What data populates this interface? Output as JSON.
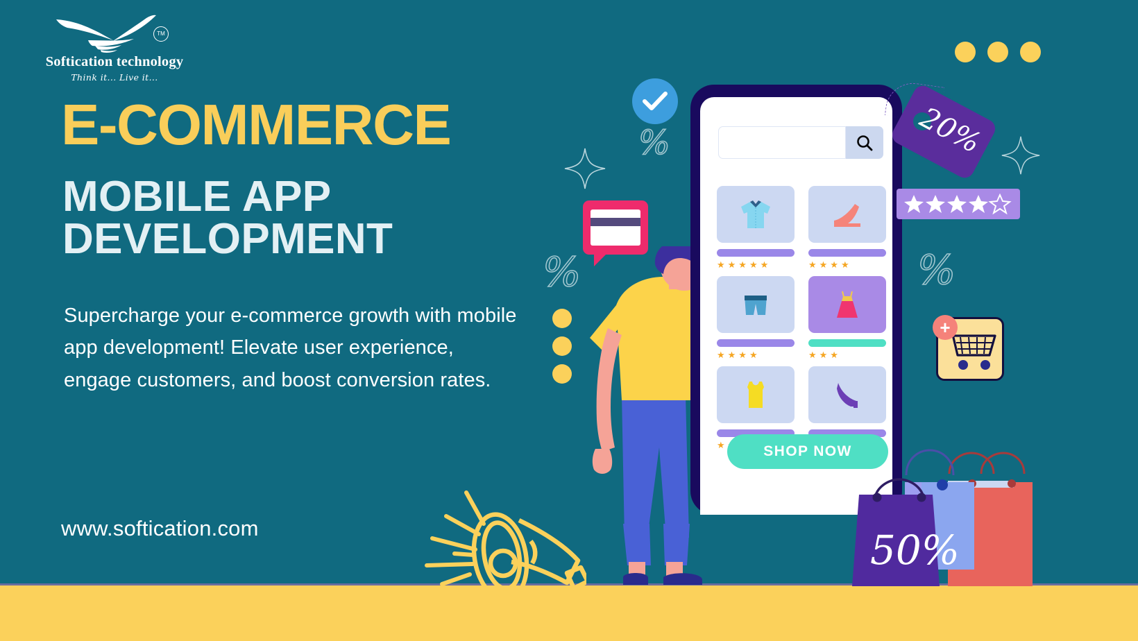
{
  "brand": {
    "logo_name": "Softication technology",
    "logo_tagline": "Think it... Live it...",
    "trademark": "TM"
  },
  "headline": {
    "line1": "E-COMMERCE",
    "line2a": "MOBILE APP",
    "line2b": "DEVELOPMENT"
  },
  "body_text": "Supercharge your e-commerce growth with mobile app development! Elevate user experience, engage customers, and boost conversion rates.",
  "url": "www.softication.com",
  "phone": {
    "search_placeholder": "",
    "search_icon": "magnifier-icon",
    "cta_label": "SHOP NOW",
    "products": [
      {
        "name": "blue-shirt",
        "stars": 5,
        "bar_color": "#9a87e8",
        "thumb_bg": "#ccd8f2"
      },
      {
        "name": "pink-heel-shoe",
        "stars": 4,
        "bar_color": "#9a87e8",
        "thumb_bg": "#ccd8f2"
      },
      {
        "name": "denim-shorts",
        "stars": 4,
        "bar_color": "#9a87e8",
        "thumb_bg": "#ccd8f2"
      },
      {
        "name": "pink-dress",
        "stars": 3,
        "bar_color": "#4fdfc4",
        "thumb_bg": "#a98ae6"
      },
      {
        "name": "yellow-tank-top",
        "stars": 4,
        "bar_color": "#9a87e8",
        "thumb_bg": "#ccd8f2"
      },
      {
        "name": "purple-heel-shoe",
        "stars": 3,
        "bar_color": "#9a87e8",
        "thumb_bg": "#ccd8f2"
      }
    ]
  },
  "badges": {
    "price_tag_discount": "20%",
    "bag_discount": "50%",
    "rating_filled_stars": 4,
    "rating_empty_stars": 1,
    "verified_icon": "check-circle-icon",
    "cart_icon": "add-to-cart-icon",
    "card_icon": "credit-card-icon",
    "megaphone_icon": "megaphone-icon"
  },
  "decor": {
    "percent_symbol": "%",
    "top_right_dots": 3,
    "left_dots": 3
  },
  "colors": {
    "background": "#106a80",
    "accent_yellow": "#fbd15b",
    "headline_yellow": "#f9ce5a",
    "headline_white": "#e3f0f4",
    "phone_frame": "#190a5e",
    "mint": "#4fdfc4",
    "purple": "#5a2d9c",
    "light_purple": "#a98ae6",
    "pink": "#ee2b6c",
    "blue_check": "#3d9ede",
    "coral": "#e8645c"
  }
}
